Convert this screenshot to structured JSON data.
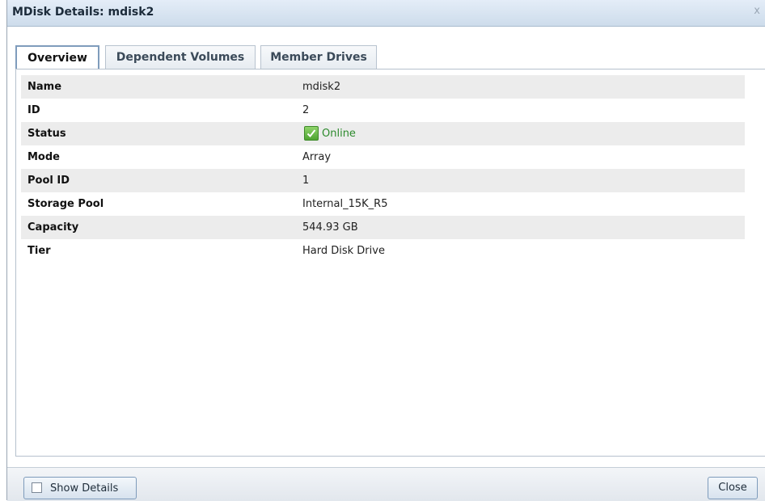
{
  "dialog": {
    "title": "MDisk Details: mdisk2",
    "close_glyph": "x"
  },
  "tabs": [
    {
      "label": "Overview",
      "active": true
    },
    {
      "label": "Dependent Volumes",
      "active": false
    },
    {
      "label": "Member Drives",
      "active": false
    }
  ],
  "details": [
    {
      "label": "Name",
      "value": "mdisk2"
    },
    {
      "label": "ID",
      "value": "2"
    },
    {
      "label": "Status",
      "value": "Online",
      "icon": "checkmark-icon"
    },
    {
      "label": "Mode",
      "value": "Array"
    },
    {
      "label": "Pool ID",
      "value": "1"
    },
    {
      "label": "Storage Pool",
      "value": "Internal_15K_R5"
    },
    {
      "label": "Capacity",
      "value": "544.93 GB"
    },
    {
      "label": "Tier",
      "value": "Hard Disk Drive"
    }
  ],
  "footer": {
    "show_details_label": "Show Details",
    "show_details_checked": false,
    "close_label": "Close"
  },
  "colors": {
    "status_online": "#2c8a2c",
    "title_bar": "#d6e2ef",
    "row_shade": "#ececec"
  }
}
